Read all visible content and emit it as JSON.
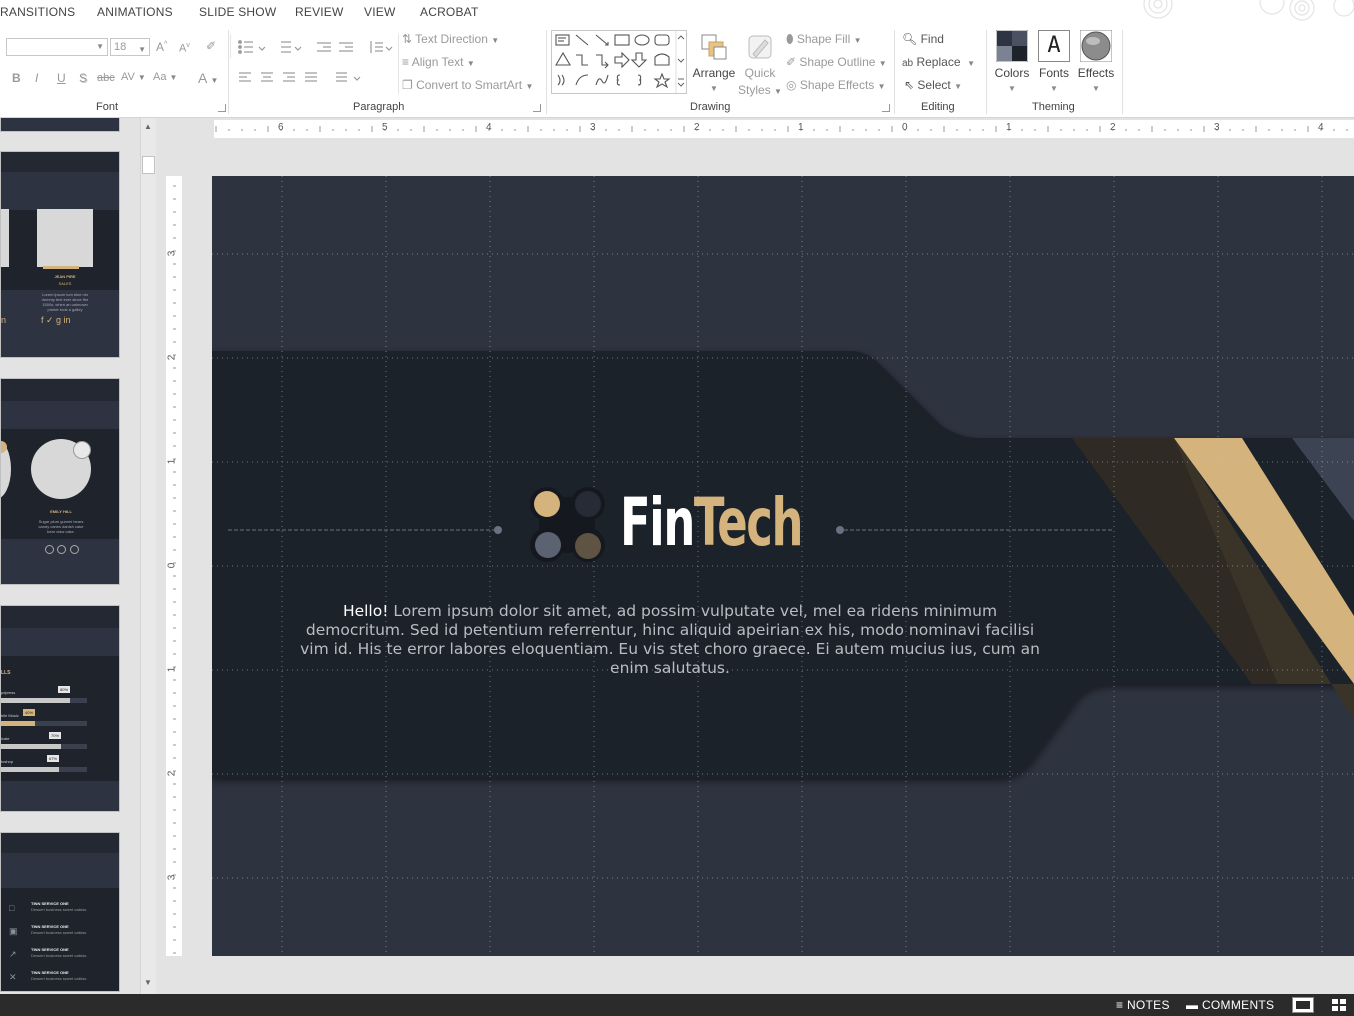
{
  "menu": {
    "tabs": [
      "RANSITIONS",
      "ANIMATIONS",
      "SLIDE SHOW",
      "REVIEW",
      "VIEW",
      "ACROBAT"
    ]
  },
  "ribbon": {
    "font": {
      "label": "Font",
      "font_name": "",
      "font_size": "18",
      "buttons": [
        "B",
        "I",
        "U",
        "S",
        "abc",
        "AV",
        "Aa",
        "A"
      ]
    },
    "paragraph": {
      "label": "Paragraph",
      "text_direction": "Text Direction",
      "align_text": "Align Text",
      "convert_smartart": "Convert to SmartArt"
    },
    "drawing": {
      "label": "Drawing",
      "arrange": "Arrange",
      "quick_styles_1": "Quick",
      "quick_styles_2": "Styles",
      "shape_fill": "Shape Fill",
      "shape_outline": "Shape Outline",
      "shape_effects": "Shape Effects"
    },
    "editing": {
      "label": "Editing",
      "find": "Find",
      "replace": "Replace",
      "select": "Select"
    },
    "theming": {
      "label": "Theming",
      "colors": "Colors",
      "fonts": "Fonts",
      "fonts_glyph": "A",
      "effects": "Effects"
    }
  },
  "rulers": {
    "horizontal": [
      "6",
      "5",
      "4",
      "3",
      "2",
      "1",
      "0",
      "1",
      "2",
      "3",
      "4"
    ],
    "vertical": [
      "3",
      "2",
      "1",
      "0",
      "1",
      "2",
      "3"
    ]
  },
  "thumbnails": {
    "slide_a": {
      "name": "JEAN PIRE",
      "role": "SALES",
      "body": "Lorem ipsum lum bine nin dummy text ever since the 1500s, when an unknown printer took a galley"
    },
    "slide_b": {
      "name": "EMILY HILL",
      "body": "Sugar plum gummi bears candy canes danish cake bear claw cake."
    },
    "slide_c": {
      "title": "LLS",
      "bars": [
        {
          "label": "pdpress",
          "pct": "80%",
          "fill": 0.8
        },
        {
          "label": "bile Music",
          "pct": "40%",
          "fill": 0.4
        },
        {
          "label": "icate",
          "pct": "70%",
          "fill": 0.7
        },
        {
          "label": "toshop",
          "pct": "67%",
          "fill": 0.67
        }
      ]
    },
    "slide_d": {
      "items": [
        {
          "title": "TINN SERVICE ONE",
          "sub": "Dessert business sweet caikiss"
        },
        {
          "title": "TINN SERVICE ONE",
          "sub": "Dessert business sweet caikiss"
        },
        {
          "title": "TINN SERVICE ONE",
          "sub": "Dessert business sweet caikiss"
        },
        {
          "title": "TINN SERVICE ONE",
          "sub": "Dessert business sweet caikiss"
        }
      ]
    }
  },
  "slide": {
    "logo_fin": "Fin",
    "logo_tech": "Tech",
    "hello": "Hello!",
    "body": " Lorem ipsum dolor sit amet, ad possim vulputate vel, mel ea ridens minimum democritum. Sed id petentium referrentur, hinc aliquid apeirian ex his, modo nominavi facilisi vim id. His te error labores eloquentiam. Eu vis stet choro graece. Ei autem mucius ius, cum an enim salutatus.",
    "colors": {
      "background": "#2e3340",
      "band": "#1f232c",
      "gold": "#d4b47c",
      "grey_blue": "#5b6272",
      "dark_gold": "#5f5443"
    }
  },
  "status": {
    "notes": "NOTES",
    "comments": "COMMENTS"
  }
}
